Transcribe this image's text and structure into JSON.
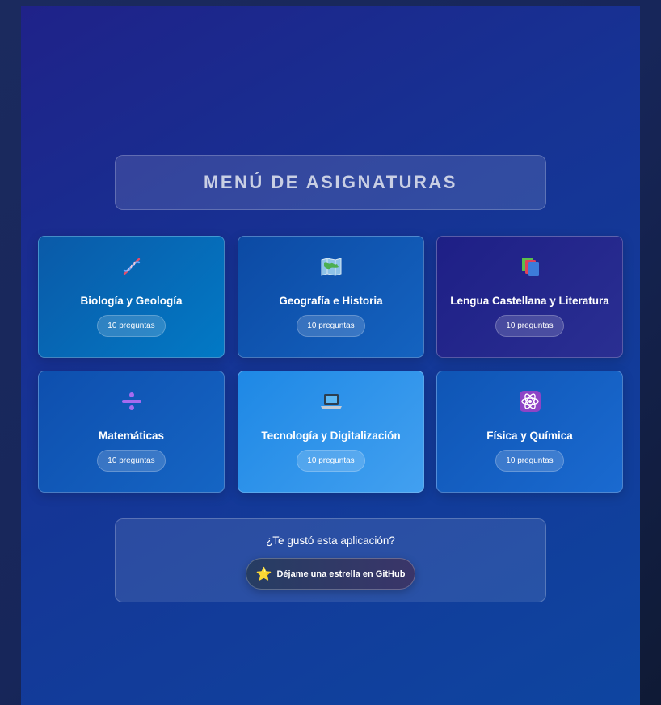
{
  "title": "MENÚ DE ASIGNATURAS",
  "subjects": [
    {
      "name": "Biología y Geología",
      "count": "10 preguntas",
      "icon": "dna-icon"
    },
    {
      "name": "Geografía e Historia",
      "count": "10 preguntas",
      "icon": "map-icon"
    },
    {
      "name": "Lengua Castellana y Literatura",
      "count": "10 preguntas",
      "icon": "books-icon"
    },
    {
      "name": "Matemáticas",
      "count": "10 preguntas",
      "icon": "divide-icon"
    },
    {
      "name": "Tecnología y Digitalización",
      "count": "10 preguntas",
      "icon": "laptop-icon"
    },
    {
      "name": "Física y Química",
      "count": "10 preguntas",
      "icon": "atom-icon"
    }
  ],
  "feedback": {
    "question": "¿Te gustó esta aplicación?",
    "button_label": "Déjame una estrella en GitHub",
    "button_icon": "star-icon"
  },
  "colors": {
    "accent_star": "#f6c026",
    "background": "#163394"
  }
}
